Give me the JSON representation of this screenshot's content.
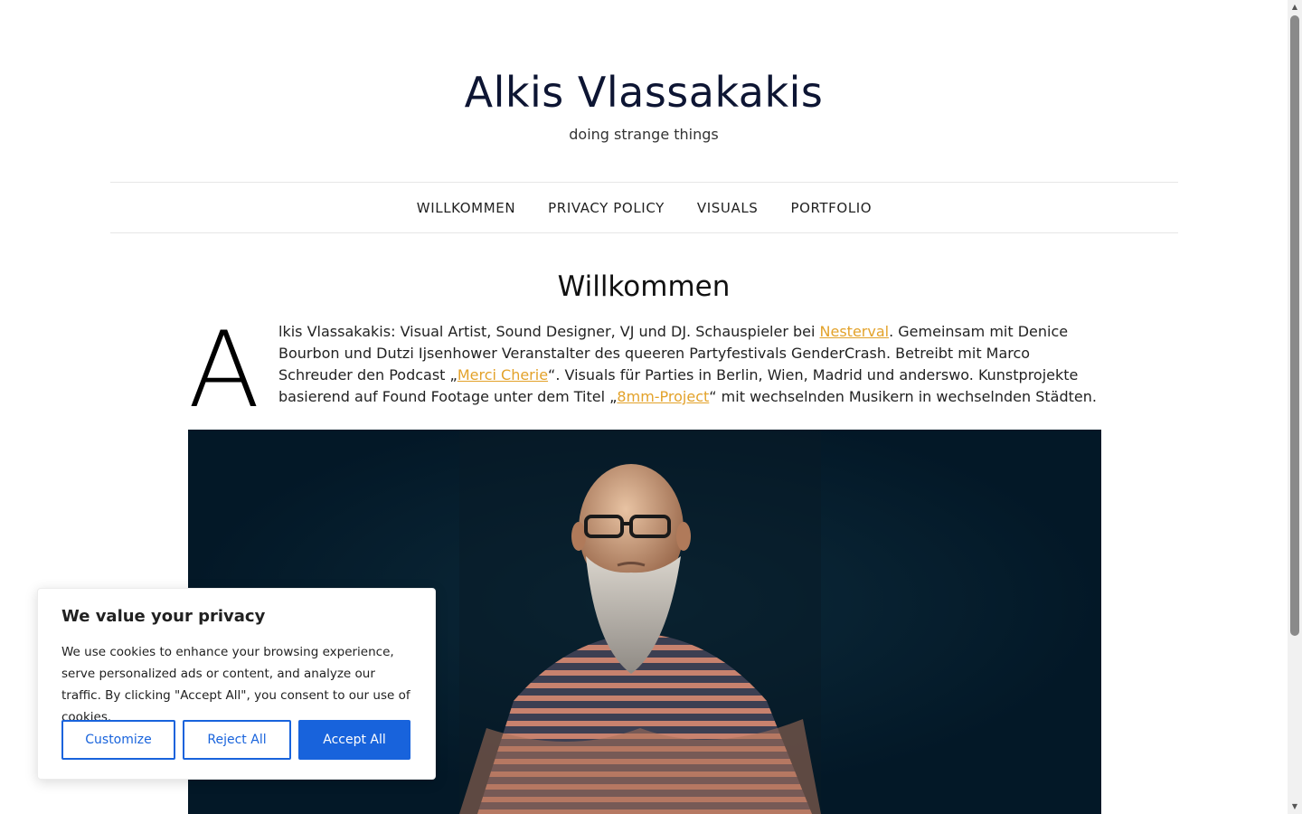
{
  "site": {
    "title": "Alkis Vlassakakis",
    "tagline": "doing strange things"
  },
  "nav": {
    "items": [
      {
        "label": "WILLKOMMEN"
      },
      {
        "label": "PRIVACY POLICY"
      },
      {
        "label": "VISUALS"
      },
      {
        "label": "PORTFOLIO"
      }
    ]
  },
  "entry": {
    "title": "Willkommen",
    "dropcap": "A",
    "text_1": "lkis Vlassakakis: Visual Artist, Sound Designer, VJ und DJ. Schauspieler bei ",
    "link_nesterval": "Nesterval",
    "text_2": ". Gemeinsam mit Denice Bourbon und Dutzi Ijsenhower Veranstalter des queeren Partyfestivals GenderCrash. Betreibt mit Marco Schreuder den Podcast „",
    "link_merci": "Merci Cherie",
    "text_3": "“. Visuals für Parties in Berlin, Wien, Madrid und anderswo. Kunstprojekte basierend auf Found Footage unter dem Titel „",
    "link_8mm": "8mm-Project",
    "text_4": "“ mit wechselnden Musikern in wechselnden Städten."
  },
  "cookie": {
    "title": "We value your privacy",
    "text": "We use cookies to enhance your browsing experience, serve personalized ads or content, and analyze our traffic. By clicking \"Accept All\", you consent to our use of cookies.",
    "customize": "Customize",
    "reject": "Reject All",
    "accept": "Accept All"
  },
  "colors": {
    "link": "#e3a22a",
    "accent": "#1863dc",
    "photo_bg": "#031827"
  }
}
